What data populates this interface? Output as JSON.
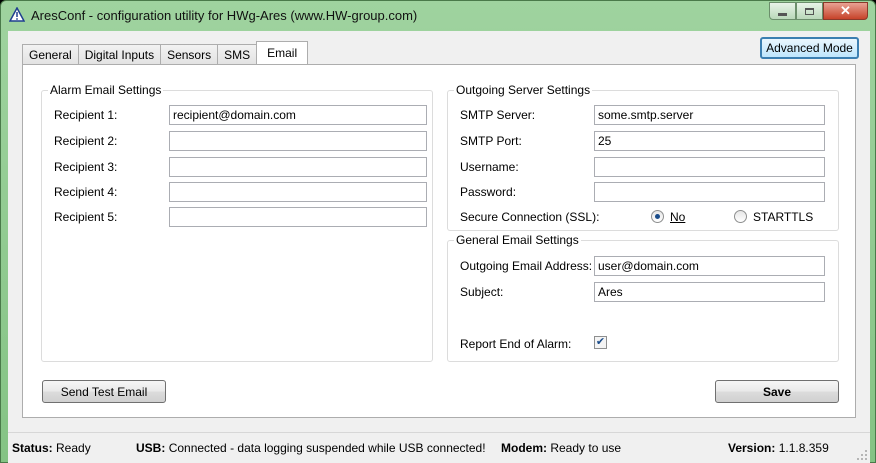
{
  "window": {
    "title": "AresConf - configuration utility for HWg-Ares (www.HW-group.com)",
    "controls": {
      "minimize": "minimize",
      "maximize": "maximize",
      "close": "✕"
    }
  },
  "tabs": [
    {
      "label": "General"
    },
    {
      "label": "Digital Inputs"
    },
    {
      "label": "Sensors"
    },
    {
      "label": "SMS"
    },
    {
      "label": "Email",
      "active": true
    }
  ],
  "advanced_mode_label": "Advanced Mode",
  "alarm_email": {
    "title": "Alarm Email Settings",
    "recipients": [
      {
        "label": "Recipient 1:",
        "value": "recipient@domain.com"
      },
      {
        "label": "Recipient 2:",
        "value": ""
      },
      {
        "label": "Recipient 3:",
        "value": ""
      },
      {
        "label": "Recipient 4:",
        "value": ""
      },
      {
        "label": "Recipient 5:",
        "value": ""
      }
    ]
  },
  "outgoing_server": {
    "title": "Outgoing Server Settings",
    "smtp_server": {
      "label": "SMTP Server:",
      "value": "some.smtp.server"
    },
    "smtp_port": {
      "label": "SMTP Port:",
      "value": "25"
    },
    "username": {
      "label": "Username:",
      "value": ""
    },
    "password": {
      "label": "Password:",
      "value": ""
    },
    "ssl": {
      "label": "Secure Connection (SSL):",
      "options": [
        {
          "label": "No",
          "checked": true
        },
        {
          "label": "STARTTLS",
          "checked": false
        }
      ]
    }
  },
  "general_email": {
    "title": "General Email Settings",
    "outgoing_address": {
      "label": "Outgoing Email Address:",
      "value": "user@domain.com"
    },
    "subject": {
      "label": "Subject:",
      "value": "Ares"
    },
    "report_end": {
      "label": "Report End of Alarm:",
      "checked": true
    }
  },
  "buttons": {
    "send_test_email": "Send Test Email",
    "save": "Save"
  },
  "status_bar": {
    "status": {
      "key": "Status:",
      "value": "Ready"
    },
    "usb": {
      "key": "USB:",
      "value": "Connected - data logging suspended while USB connected!"
    },
    "modem": {
      "key": "Modem:",
      "value": "Ready to use"
    },
    "version": {
      "key": "Version:",
      "value": "1.1.8.359"
    }
  },
  "colors": {
    "titlebar": "#8fcb8f",
    "panel_bg": "#f0f0f0",
    "accent_blue": "#3c7fb1"
  }
}
